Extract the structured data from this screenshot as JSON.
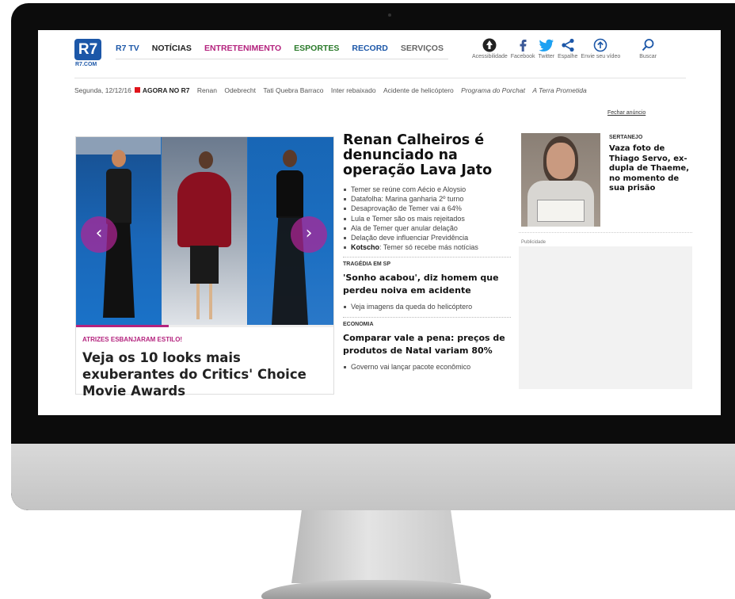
{
  "logo": {
    "text": "R7",
    "domain": "R7.COM",
    "color": "#1c57a8"
  },
  "nav": {
    "items": [
      {
        "label": "R7 TV",
        "color": "#1c57a8"
      },
      {
        "label": "NOTÍCIAS",
        "color": "#222222"
      },
      {
        "label": "ENTRETENIMENTO",
        "color": "#b4237e"
      },
      {
        "label": "ESPORTES",
        "color": "#2a7a2a"
      },
      {
        "label": "RECORD",
        "color": "#1c57a8"
      },
      {
        "label": "SERVIÇOS",
        "color": "#666666"
      }
    ]
  },
  "tools": [
    {
      "label": "Acessibilidade",
      "icon": "accessibility-icon",
      "color": "#222222"
    },
    {
      "label": "Facebook",
      "icon": "facebook-icon",
      "color": "#3b5998"
    },
    {
      "label": "Twitter",
      "icon": "twitter-icon",
      "color": "#1da1f2"
    },
    {
      "label": "Espalhe",
      "icon": "share-icon",
      "color": "#1c57a8"
    },
    {
      "label": "Envie seu vídeo",
      "icon": "upload-icon",
      "color": "#1c57a8"
    },
    {
      "label": "Buscar",
      "icon": "search-icon",
      "color": "#1c57a8"
    }
  ],
  "ticker": {
    "date": "Segunda, 12/12/16",
    "live_label": "AGORA NO R7",
    "live_color": "#e0141b",
    "items": [
      "Renan",
      "Odebrecht",
      "Tati Quebra Barraco",
      "Inter rebaixado",
      "Acidente de helicóptero"
    ],
    "italic_items": [
      "Programa do Porchat",
      "A Terra Prometida"
    ]
  },
  "close_ad": "Fechar anúncio",
  "feature": {
    "kicker": "ATRIZES ESBANJARAM ESTILO!",
    "title": "Veja os 10 looks mais exuberantes do Critics' Choice Movie Awards",
    "prev_arrow": "‹",
    "next_arrow": "›",
    "progress": 0.36,
    "accent": "#b4237e"
  },
  "middle": {
    "title": "Renan Calheiros é denunciado na operação Lava Jato",
    "bullets": [
      {
        "text": "Temer se reúne com Aécio e Aloysio"
      },
      {
        "text": "Datafolha: Marina ganharia 2º turno"
      },
      {
        "text": "Desaprovação de Temer vai a 64%"
      },
      {
        "text": "Lula e Temer são os mais rejeitados"
      },
      {
        "text": "Ala de Temer quer anular delação"
      },
      {
        "text": "Delação deve influenciar Previdência"
      },
      {
        "bold": "Kotscho",
        "text": ": Temer só recebe más notícias"
      }
    ],
    "section2": {
      "kicker": "TRAGÉDIA EM SP",
      "title": "'Sonho acabou', diz homem que perdeu noiva em acidente",
      "bullets": [
        "Veja imagens da queda do helicóptero"
      ]
    },
    "section3": {
      "kicker": "ECONOMIA",
      "title": "Comparar vale a pena: preços de produtos de Natal variam 80%",
      "bullets": [
        "Governo vai lançar pacote econômico"
      ]
    }
  },
  "right": {
    "kicker": "SERTANEJO",
    "title": "Vaza foto de Thiago Servo, ex-dupla de Thaeme, no momento de sua prisão",
    "ad_label": "Publicidade"
  }
}
